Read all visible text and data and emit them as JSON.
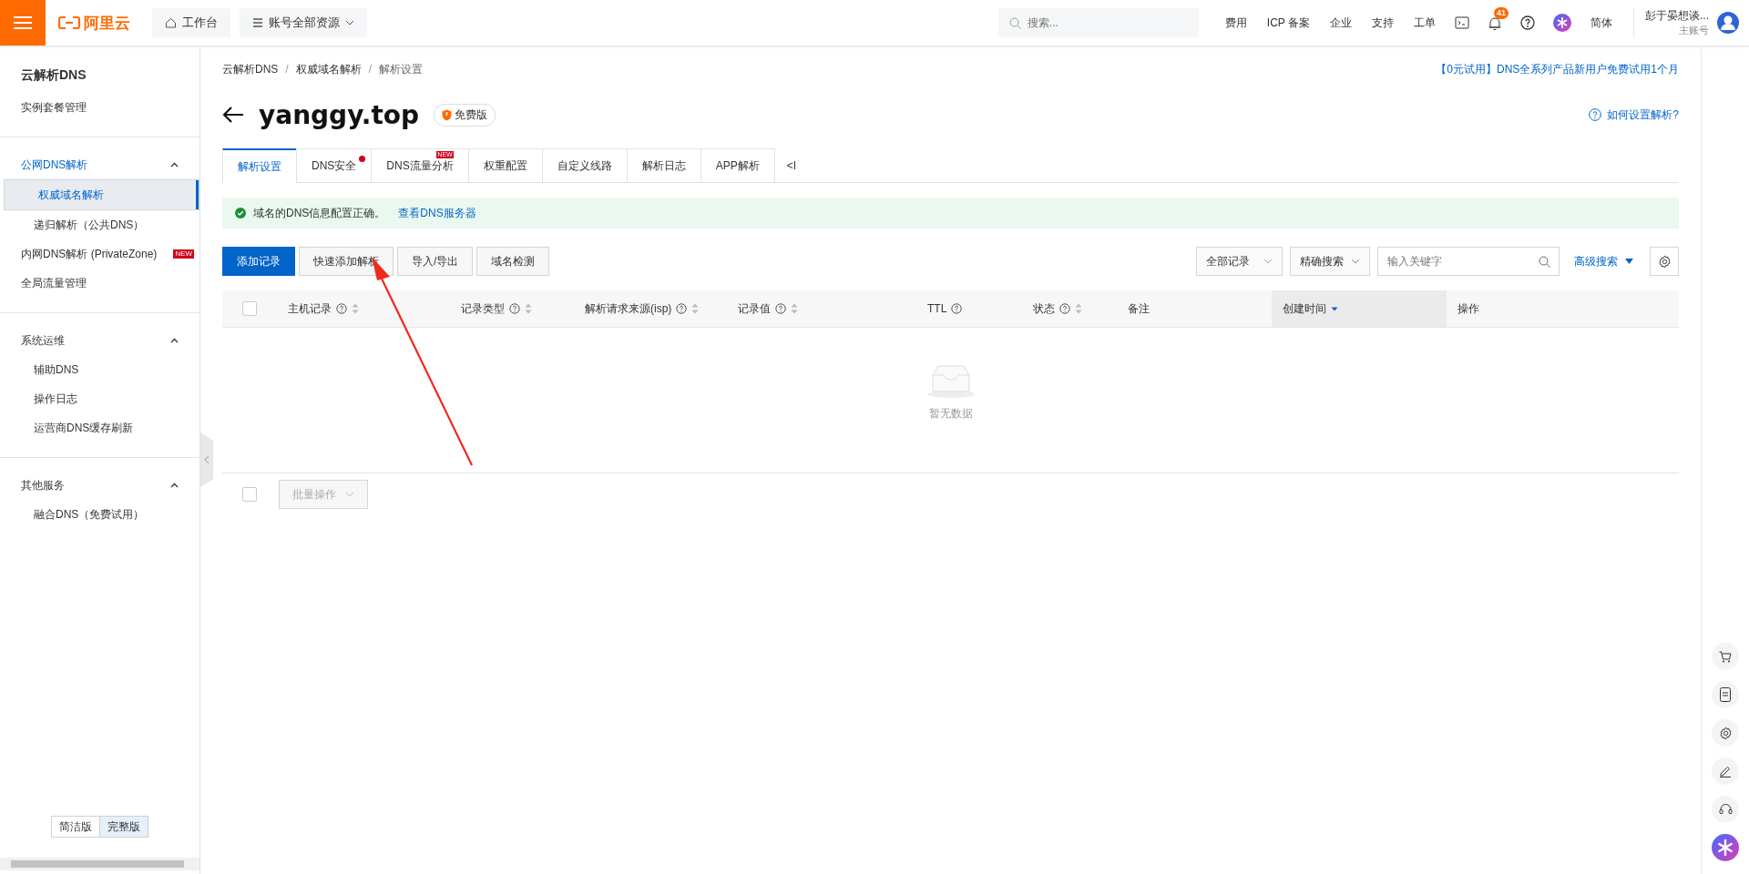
{
  "topbar": {
    "logo": "阿里云",
    "workbench": "工作台",
    "resources": "账号全部资源",
    "search": {
      "placeholder": "搜索..."
    },
    "links": [
      "费用",
      "ICP 备案",
      "企业",
      "支持",
      "工单"
    ],
    "notifications": "41",
    "language": "简体",
    "user": {
      "name": "彭于晏想谈...",
      "role": "主账号"
    }
  },
  "sidebar": {
    "title": "云解析DNS",
    "groups": [
      [
        {
          "label": "实例套餐管理",
          "selected": false
        }
      ],
      [
        {
          "label": "公网DNS解析",
          "active": true,
          "expanded": true,
          "children": [
            {
              "label": "权威域名解析",
              "selected": true
            },
            {
              "label": "递归解析（公共DNS）",
              "selected": false
            }
          ]
        },
        {
          "label": "内网DNS解析 (PrivateZone)",
          "selected": false,
          "badge": "NEW"
        },
        {
          "label": "全局流量管理",
          "selected": false
        }
      ],
      [
        {
          "label": "系统运维",
          "active": false,
          "expanded": true,
          "children": [
            {
              "label": "辅助DNS",
              "selected": false
            },
            {
              "label": "操作日志",
              "selected": false
            },
            {
              "label": "运营商DNS缓存刷新",
              "selected": false
            }
          ]
        }
      ],
      [
        {
          "label": "其他服务",
          "active": false,
          "expanded": true,
          "children": [
            {
              "label": "融合DNS（免费试用）",
              "selected": false
            }
          ]
        }
      ]
    ],
    "modes": [
      {
        "label": "简洁版",
        "selected": false
      },
      {
        "label": "完整版",
        "selected": true
      }
    ]
  },
  "breadcrumb": [
    {
      "label": "云解析DNS"
    },
    {
      "separator": "/",
      "label": "权威域名解析"
    },
    {
      "separator": "/",
      "label": "解析设置"
    }
  ],
  "promo": "【0元试用】DNS全系列产品新用户免费试用1个月",
  "domain": "yanggy.top",
  "edition": "免费版",
  "help": "如何设置解析?",
  "tabs": [
    {
      "label": "解析设置",
      "selected": true
    },
    {
      "label": "DNS安全",
      "selected": false,
      "dot": true
    },
    {
      "label": "DNS流量分析",
      "selected": false,
      "badge": "NEW"
    },
    {
      "label": "权重配置",
      "selected": false
    },
    {
      "label": "自定义线路",
      "selected": false
    },
    {
      "label": "解析日志",
      "selected": false
    },
    {
      "label": "APP解析",
      "selected": false
    }
  ],
  "tabs_collapse": "<I",
  "alert": {
    "text": "域名的DNS信息配置正确。",
    "link": "查看DNS服务器"
  },
  "actions": [
    {
      "label": "添加记录",
      "kind": "primary"
    },
    {
      "label": "快速添加解析",
      "kind": "default"
    },
    {
      "label": "导入/导出",
      "kind": "default"
    },
    {
      "label": "域名检测",
      "kind": "default"
    }
  ],
  "filters": {
    "record_type": "全部记录",
    "search_mode": "精确搜索",
    "keyword": {
      "placeholder": "输入关键字"
    },
    "advanced": "高级搜索"
  },
  "table": {
    "select_all": {
      "checked": false
    },
    "columns": [
      {
        "label": "主机记录",
        "help": true,
        "sortable": true,
        "sorted_desc": false
      },
      {
        "label": "记录类型",
        "help": true,
        "sortable": true,
        "sorted_desc": false
      },
      {
        "label": "解析请求来源(isp)",
        "help": true,
        "sortable": true,
        "sorted_desc": false
      },
      {
        "label": "记录值",
        "help": true,
        "sortable": true,
        "sorted_desc": false
      },
      {
        "label": "TTL",
        "help": true,
        "sortable": false,
        "sorted_desc": false
      },
      {
        "label": "状态",
        "help": true,
        "sortable": true,
        "sorted_desc": false
      },
      {
        "label": "备注",
        "help": false,
        "sortable": false,
        "sorted_desc": false
      },
      {
        "label": "创建时间",
        "help": false,
        "sortable": true,
        "sorted_desc": true
      },
      {
        "label": "操作",
        "help": false,
        "sortable": false,
        "sorted_desc": false
      }
    ],
    "empty": "暂无数据",
    "batch_select": {
      "checked": false
    },
    "batch": "批量操作"
  }
}
